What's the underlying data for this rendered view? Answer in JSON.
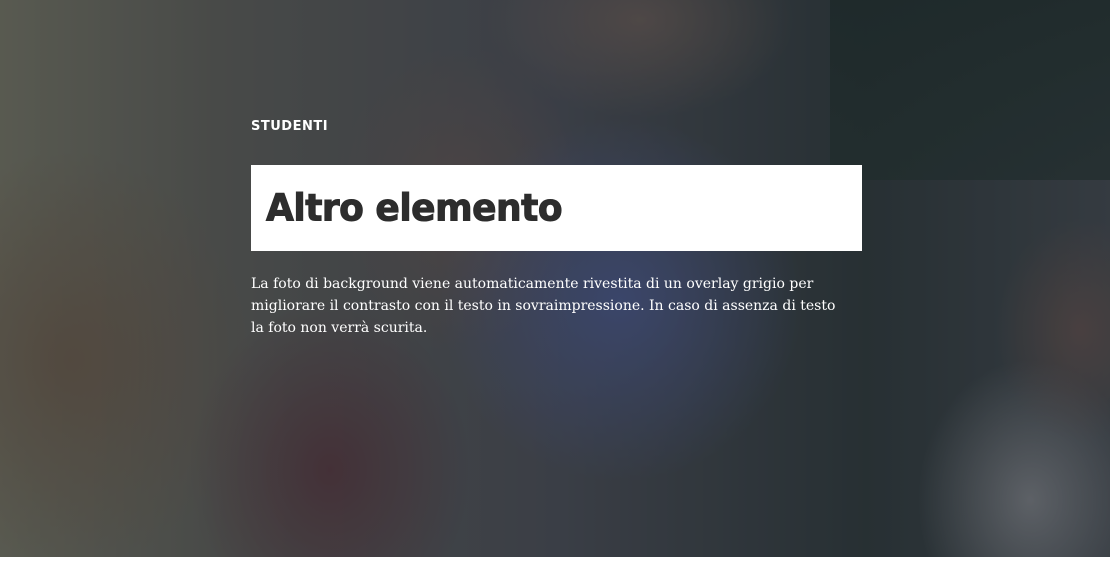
{
  "hero": {
    "eyebrow": "STUDENTI",
    "title": "Altro elemento",
    "description": "La foto di background viene automaticamente rivestita di un overlay grigio per migliorare il contrasto con il testo in sovraimpressione. In caso di assenza di testo la foto non verrà scurita."
  },
  "colors": {
    "overlay": "#23262d",
    "title_box": "#ffffff",
    "title_text": "#2d2d2d",
    "text": "#ffffff"
  }
}
